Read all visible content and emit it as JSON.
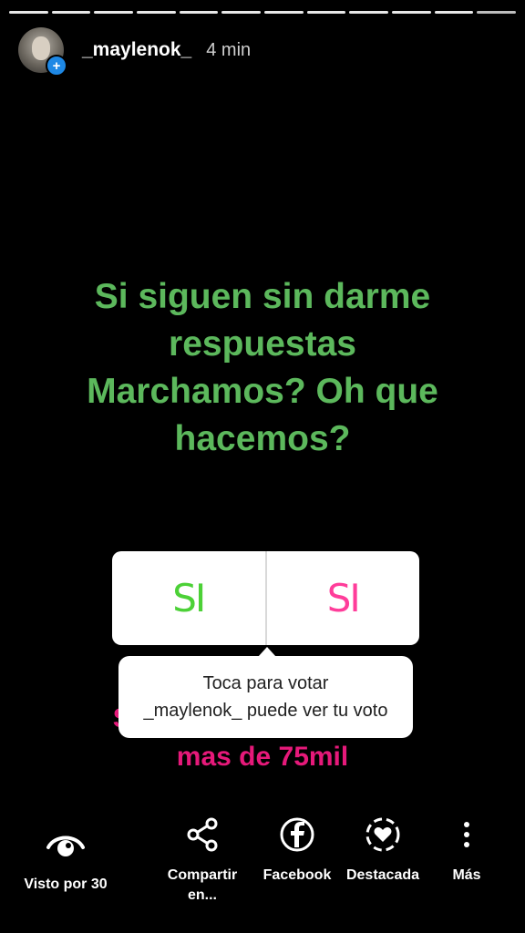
{
  "progress": {
    "segments": 12,
    "current": 12
  },
  "header": {
    "username": "_maylenok_",
    "time": "4 min",
    "avatar_badge": "+"
  },
  "story": {
    "text_lines": [
      "Si siguen sin darme",
      "respuestas",
      "Marchamos? Oh que",
      "hacemos?"
    ],
    "text_color": "#5cb85c",
    "behind_text_lines": [
      "Si no contestan somos",
      "mas de 75mil"
    ],
    "behind_text_color": "#e6197a"
  },
  "poll": {
    "option_left": "SI",
    "option_left_color": "#4cd137",
    "option_right": "SI",
    "option_right_color": "#ff3d9a"
  },
  "tooltip": {
    "line1": "Toca para votar",
    "line2": "_maylenok_ puede ver tu voto"
  },
  "bottom_bar": {
    "seen": "Visto por 30",
    "share": "Compartir en...",
    "facebook": "Facebook",
    "highlight": "Destacada",
    "more": "Más",
    "icons": {
      "seen": "eye-icon",
      "share": "share-icon",
      "facebook": "facebook-icon",
      "highlight": "highlight-heart-icon",
      "more": "more-vertical-icon"
    }
  }
}
